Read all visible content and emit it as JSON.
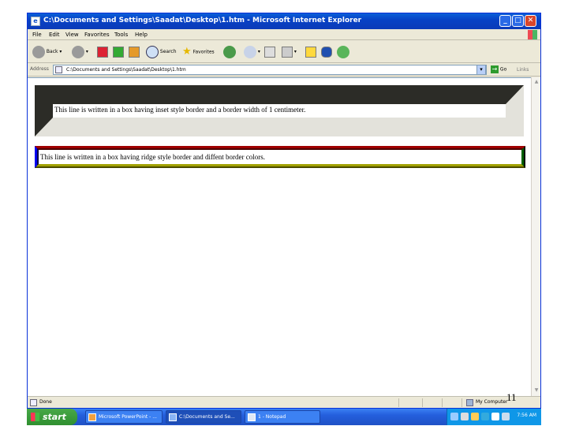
{
  "window": {
    "title": "C:\\Documents and Settings\\Saadat\\Desktop\\1.htm - Microsoft Internet Explorer",
    "minimize": "_",
    "maximize": "□",
    "close": "✕"
  },
  "menu": [
    "File",
    "Edit",
    "View",
    "Favorites",
    "Tools",
    "Help"
  ],
  "toolbar": {
    "back_label": "Back",
    "search_label": "Search",
    "favorites_label": "Favorites"
  },
  "address": {
    "label": "Address",
    "value": "C:\\Documents and Settings\\Saadat\\Desktop\\1.htm",
    "go_label": "Go",
    "links_label": "Links"
  },
  "content": {
    "inset_line": "This line is written in a box having inset style border and a border width of 1 centimeter.",
    "ridge_line": "This line is written in a box having ridge style border and diffent border colors."
  },
  "status": {
    "text": "Done",
    "zone": "My Computer"
  },
  "taskbar": {
    "start_label": "start",
    "tasks": [
      "Microsoft PowerPoint - ...",
      "C:\\Documents and Se...",
      "1 - Notepad"
    ],
    "clock": "7:56 AM"
  },
  "slide_number": "11",
  "colors": {
    "ridge_top": "#a00000",
    "ridge_right": "#006000",
    "ridge_bottom": "#a0a000",
    "ridge_left": "#00009c",
    "titlebar": "#0a5fd8"
  },
  "icons": [
    "ie-page-icon",
    "back-arrow-icon",
    "forward-arrow-icon",
    "stop-icon",
    "refresh-icon",
    "home-icon",
    "search-icon",
    "star-icon",
    "history-icon",
    "mail-icon",
    "print-icon",
    "edit-icon",
    "bluetooth-icon",
    "messenger-icon",
    "go-arrow-icon",
    "my-computer-icon"
  ]
}
